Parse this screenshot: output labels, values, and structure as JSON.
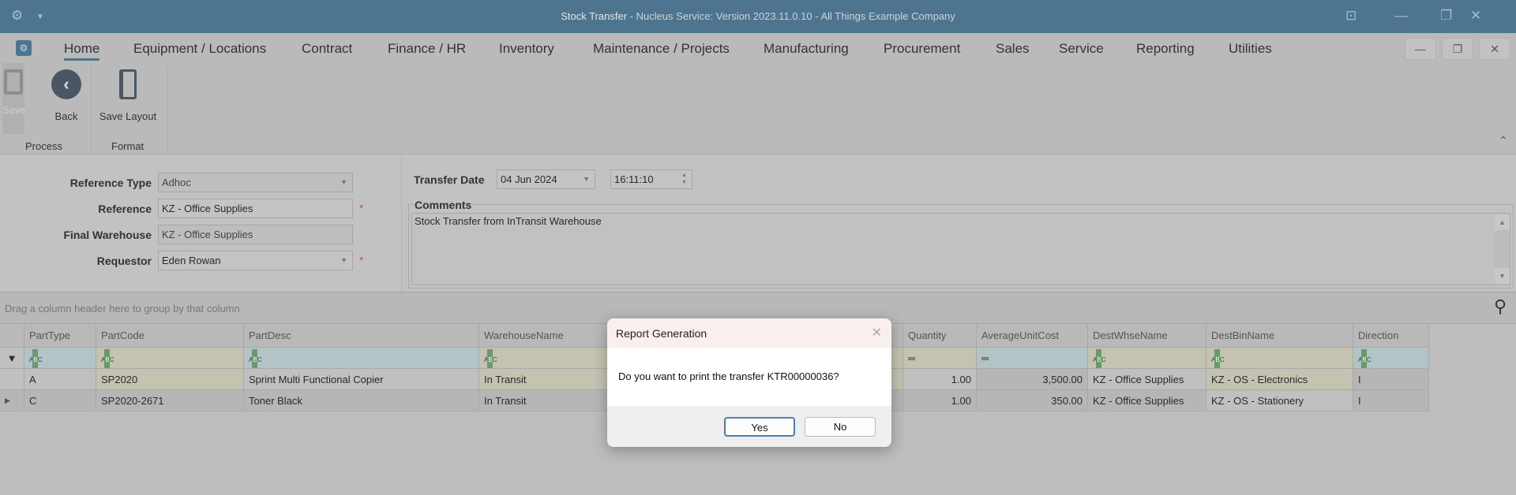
{
  "window": {
    "title_main": "Stock Transfer",
    "title_rest": " - Nucleus Service: Version 2023.11.0.10 - All Things Example Company"
  },
  "menu": [
    "Home",
    "Equipment / Locations",
    "Contract",
    "Finance / HR",
    "Inventory",
    "Maintenance / Projects",
    "Manufacturing",
    "Procurement",
    "Sales",
    "Service",
    "Reporting",
    "Utilities"
  ],
  "ribbon": {
    "save": "Save",
    "back": "Back",
    "save_layout": "Save Layout",
    "group_process": "Process",
    "group_format": "Format"
  },
  "form": {
    "reference_type_label": "Reference Type",
    "reference_type": "Adhoc",
    "reference_label": "Reference",
    "reference": "KZ - Office Supplies",
    "final_warehouse_label": "Final Warehouse",
    "final_warehouse": "KZ - Office Supplies",
    "requestor_label": "Requestor",
    "requestor": "Eden Rowan",
    "required_mark": "*",
    "transfer_date_label": "Transfer Date",
    "transfer_date": "04 Jun 2024",
    "transfer_time": "16:11:10",
    "comments_label": "Comments",
    "comments": "Stock Transfer from InTransit Warehouse"
  },
  "grid": {
    "group_hint": "Drag a column header here to group by that column",
    "columns": [
      "PartType",
      "PartCode",
      "PartDesc",
      "WarehouseName",
      "Quantity",
      "AverageUnitCost",
      "DestWhseName",
      "DestBinName",
      "Direction"
    ],
    "rows": [
      [
        "A",
        "SP2020",
        "Sprint Multi Functional Copier",
        "In Transit",
        "1.00",
        "3,500.00",
        "KZ - Office Supplies",
        "KZ - OS - Electronics",
        "I"
      ],
      [
        "C",
        "SP2020-2671",
        "Toner Black",
        "In Transit",
        "1.00",
        "350.00",
        "KZ - Office Supplies",
        "KZ - OS - Stationery",
        "I"
      ]
    ]
  },
  "dialog": {
    "title": "Report Generation",
    "message": "Do you want to print the transfer KTR00000036?",
    "yes": "Yes",
    "no": "No"
  }
}
